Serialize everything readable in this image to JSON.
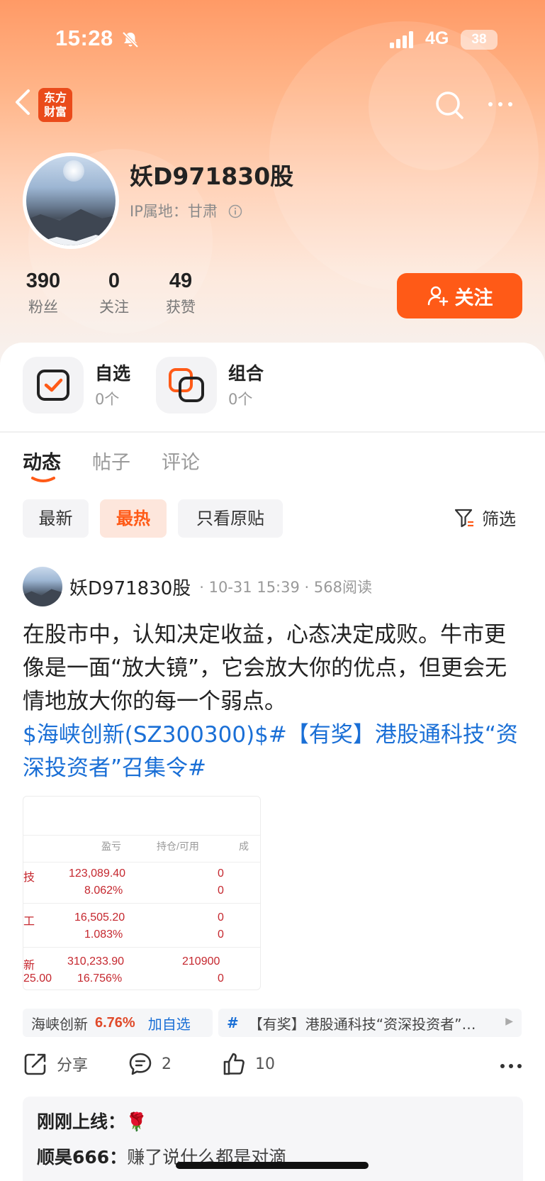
{
  "status_bar": {
    "time": "15:28",
    "network": "4G",
    "battery": "38"
  },
  "header": {
    "logo_line1": "东方",
    "logo_line2": "财富"
  },
  "profile": {
    "name": "妖D971830股",
    "ip_label": "IP属地：甘肃",
    "stats": [
      {
        "value": "390",
        "label": "粉丝"
      },
      {
        "value": "0",
        "label": "关注"
      },
      {
        "value": "49",
        "label": "获赞"
      }
    ],
    "follow_label": "关注"
  },
  "quick_links": [
    {
      "title": "自选",
      "count": "0个"
    },
    {
      "title": "组合",
      "count": "0个"
    }
  ],
  "tabs": [
    "动态",
    "帖子",
    "评论"
  ],
  "filters": {
    "chips": [
      "最新",
      "最热",
      "只看原贴"
    ],
    "active": "最热",
    "filter_label": "筛选"
  },
  "post": {
    "author": "妖D971830股",
    "meta": "· 10-31 15:39 · 568阅读",
    "text": "在股市中，认知决定收益，心态决定成败。牛市更像是一面“放大镜”，它会放大你的优点，但更会无情地放大你的每一个弱点。",
    "link_text": "$海峡创新(SZ300300)$#【有奖】港股通科技“资深投资者”召集令#",
    "image_table": {
      "headers": [
        "盈亏",
        "持仓/可用",
        "成"
      ],
      "rows": [
        {
          "name": "技",
          "pl": "123,089.40",
          "pl_pct": "8.062%",
          "hold": "0",
          "avail": "0"
        },
        {
          "name": "工",
          "pl": "16,505.20",
          "pl_pct": "1.083%",
          "hold": "0",
          "avail": "0"
        },
        {
          "name": "新",
          "name2": "25.00",
          "pl": "310,233.90",
          "pl_pct": "16.756%",
          "hold": "210900",
          "avail": "0"
        }
      ]
    },
    "stock_tag": {
      "name": "海峡创新",
      "change": "6.76%",
      "add_label": "加自选"
    },
    "topic_tag": {
      "hash": "#",
      "text": "【有奖】港股通科技“资深投资者”…"
    },
    "actions": {
      "share": "分享",
      "comments": "2",
      "likes": "10"
    },
    "comments": [
      {
        "user": "刚刚上线：",
        "text": "🌹"
      },
      {
        "user": "顺昊666：",
        "text": "赚了说什么都是对滴"
      }
    ]
  },
  "colors": {
    "accent": "#ff5a17",
    "link": "#1a6fd6",
    "loss_red": "#c5272e"
  }
}
